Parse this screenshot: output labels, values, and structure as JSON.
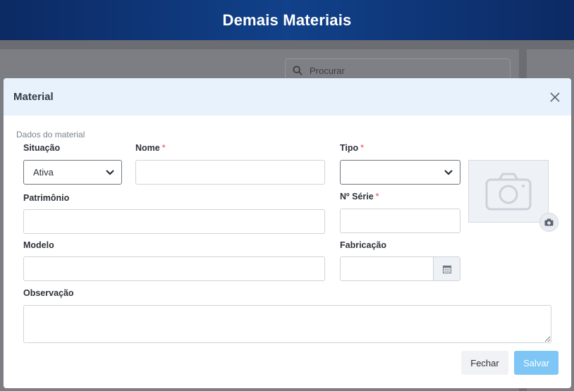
{
  "app": {
    "title": "Demais Materiais"
  },
  "background": {
    "search_placeholder": "Procurar"
  },
  "modal": {
    "title": "Material",
    "section_title": "Dados do material",
    "fields": {
      "situacao": {
        "label": "Situação",
        "value": "Ativa"
      },
      "nome": {
        "label": "Nome",
        "value": ""
      },
      "tipo": {
        "label": "Tipo",
        "value": ""
      },
      "patrimonio": {
        "label": "Patrimônio",
        "value": ""
      },
      "serie": {
        "label": "Nº Série",
        "value": ""
      },
      "modelo": {
        "label": "Modelo",
        "value": ""
      },
      "fabricacao": {
        "label": "Fabricação",
        "value": ""
      },
      "observacao": {
        "label": "Observação",
        "value": ""
      }
    },
    "buttons": {
      "close": "Fechar",
      "save": "Salvar"
    }
  },
  "icons": {
    "close": "close-icon",
    "chevron": "chevron-down-icon",
    "calendar": "calendar-icon",
    "camera": "camera-icon",
    "search": "search-icon"
  },
  "colors": {
    "header_bg": "#11418a",
    "modal_header_bg": "#e8f2fd",
    "required": "#e5484d",
    "save_button": "#7ec6f6"
  }
}
